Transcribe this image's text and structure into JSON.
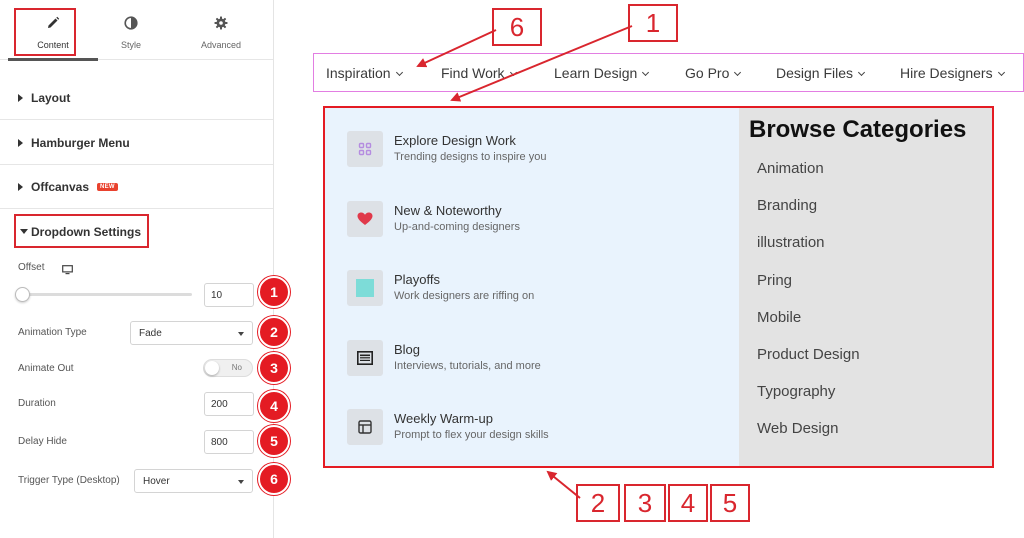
{
  "panel": {
    "tabs": [
      {
        "label": "Content",
        "icon": "pencil-icon",
        "active": true
      },
      {
        "label": "Style",
        "icon": "half-circle-icon",
        "active": false
      },
      {
        "label": "Advanced",
        "icon": "gear-icon",
        "active": false
      }
    ],
    "sections": [
      {
        "label": "Layout"
      },
      {
        "label": "Hamburger Menu"
      },
      {
        "label": "Offcanvas",
        "badge": "NEW"
      }
    ],
    "dropdown_settings": {
      "title": "Dropdown Settings",
      "offset_label": "Offset",
      "offset_value": "10",
      "offset_slider_fraction": 0.0,
      "animation_type_label": "Animation Type",
      "animation_type_value": "Fade",
      "animate_out_label": "Animate Out",
      "animate_out_toggle": "No",
      "duration_label": "Duration",
      "duration_value": "200",
      "delay_hide_label": "Delay Hide",
      "delay_hide_value": "800",
      "trigger_type_label": "Trigger Type (Desktop)",
      "trigger_type_value": "Hover"
    },
    "badges": [
      "1",
      "2",
      "3",
      "4",
      "5",
      "6"
    ]
  },
  "nav": {
    "items": [
      "Inspiration",
      "Find Work",
      "Learn Design",
      "Go Pro",
      "Design Files",
      "Hire Designers"
    ]
  },
  "dropdown": {
    "menu": [
      {
        "title": "Explore Design Work",
        "desc": "Trending designs to inspire you",
        "icon": "grid-icon",
        "icon_color": "#b58ce0"
      },
      {
        "title": "New & Noteworthy",
        "desc": "Up-and-coming designers",
        "icon": "heart-icon",
        "icon_color": "#e0394a"
      },
      {
        "title": "Playoffs",
        "desc": "Work designers are riffing on",
        "icon": "square-icon",
        "icon_color": "#7ddcd8"
      },
      {
        "title": "Blog",
        "desc": "Interviews, tutorials, and more",
        "icon": "newspaper-icon",
        "icon_color": "#222222"
      },
      {
        "title": "Weekly Warm-up",
        "desc": "Prompt to flex your design skills",
        "icon": "window-icon",
        "icon_color": "#333333"
      }
    ],
    "browse_title": "Browse Categories",
    "categories": [
      "Animation",
      "Branding",
      "illustration",
      "Pring",
      "Mobile",
      "Product Design",
      "Typography",
      "Web Design"
    ]
  },
  "annotations": {
    "top": [
      "6",
      "1"
    ],
    "bottom": [
      "2",
      "3",
      "4",
      "5"
    ]
  },
  "colors": {
    "highlight_red": "#d9262e",
    "nav_border": "#e27ee2",
    "dropdown_left_bg": "#e9f3fd",
    "dropdown_right_bg": "#e3e3e3",
    "new_badge": "#e9422e"
  }
}
